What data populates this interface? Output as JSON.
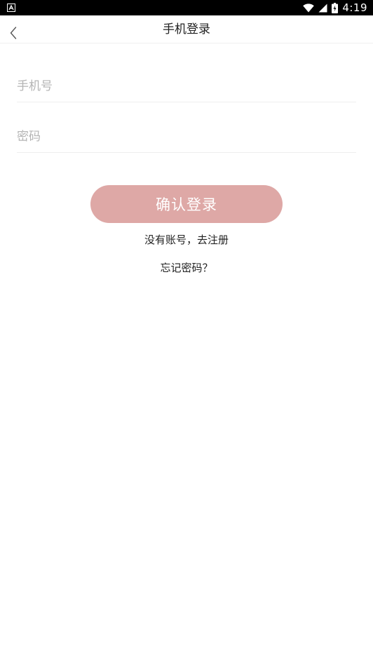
{
  "status_bar": {
    "time": "4:19",
    "icons": [
      "app-notification-icon",
      "wifi-icon",
      "cell-signal-icon",
      "battery-icon"
    ]
  },
  "header": {
    "title": "手机登录",
    "back_icon": "chevron-left-icon"
  },
  "form": {
    "phone_placeholder": "手机号",
    "password_placeholder": "密码",
    "submit_label": "确认登录"
  },
  "links": {
    "register": "没有账号，去注册",
    "forgot_password": "忘记密码？"
  },
  "colors": {
    "primary_button": "#dea8a6",
    "status_bar": "#000000",
    "placeholder": "#b4b4b4"
  }
}
